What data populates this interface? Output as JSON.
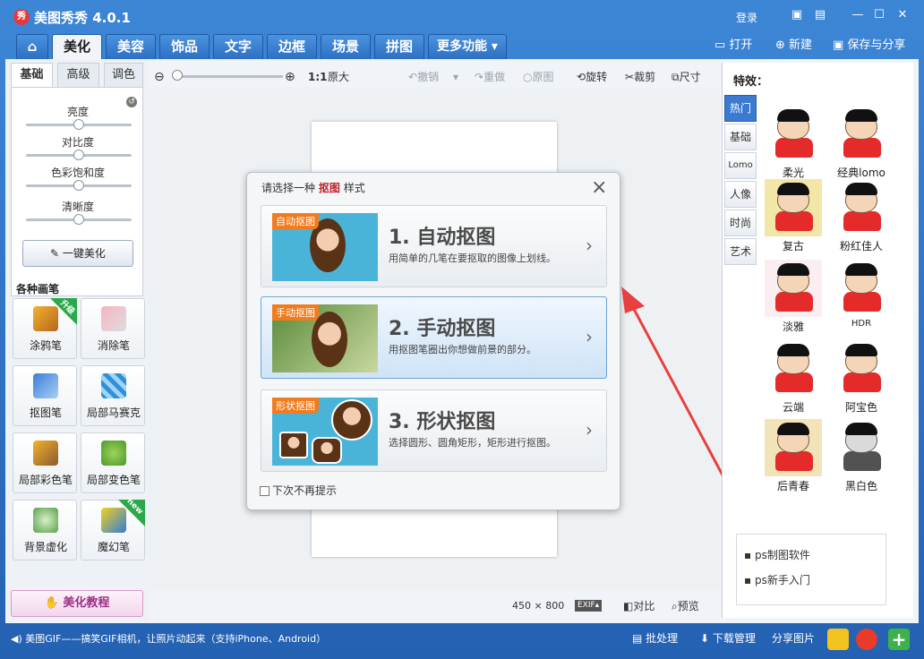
{
  "app": {
    "title": "美图秀秀 4.0.1",
    "logo": "秀",
    "login": "登录"
  },
  "tabs": [
    "美化",
    "美容",
    "饰品",
    "文字",
    "边框",
    "场景",
    "拼图",
    "更多功能 ▾"
  ],
  "right_actions": {
    "open": "打开",
    "new": "新建",
    "save": "保存与分享"
  },
  "left": {
    "subtabs": [
      "基础",
      "高级",
      "调色"
    ],
    "sliders": [
      {
        "label": "亮度",
        "value": 0.5
      },
      {
        "label": "对比度",
        "value": 0.5
      },
      {
        "label": "色彩饱和度",
        "value": 0.5
      },
      {
        "label": "清晰度",
        "value": 0.5
      }
    ],
    "auto_button": "一键美化",
    "brush_title": "各种画笔",
    "tools": [
      {
        "label": "涂鸦笔",
        "badge": "升级"
      },
      {
        "label": "消除笔",
        "badge": ""
      },
      {
        "label": "抠图笔",
        "badge": ""
      },
      {
        "label": "局部马赛克",
        "badge": ""
      },
      {
        "label": "局部彩色笔",
        "badge": ""
      },
      {
        "label": "局部变色笔",
        "badge": ""
      },
      {
        "label": "背景虚化",
        "badge": ""
      },
      {
        "label": "魔幻笔",
        "badge": "new"
      }
    ],
    "tutorial": "美化教程"
  },
  "toolbar": {
    "zoom_ratio": "1:1",
    "original_size": "原大",
    "undo": "撤销",
    "redo": "重做",
    "original": "原图",
    "rotate": "旋转",
    "crop": "裁剪",
    "size": "尺寸"
  },
  "status": {
    "dimensions": "450 × 800",
    "exif": "EXIF▴",
    "compare": "对比",
    "preview": "预览"
  },
  "dialog": {
    "title_prefix": "请选择一种",
    "title_key": "抠图",
    "title_suffix": "样式",
    "options": [
      {
        "tag": "自动抠图",
        "title": "1. 自动抠图",
        "desc": "用简单的几笔在要抠取的图像上划线。"
      },
      {
        "tag": "手动抠图",
        "title": "2. 手动抠图",
        "desc": "用抠图笔圈出你想做前景的部分。"
      },
      {
        "tag": "形状抠图",
        "title": "3. 形状抠图",
        "desc": "选择圆形、圆角矩形，矩形进行抠图。"
      }
    ],
    "no_show": "下次不再提示"
  },
  "effects": {
    "title": "特效：",
    "categories": [
      "热门",
      "基础",
      "Lomo",
      "人像",
      "时尚",
      "艺术"
    ],
    "items": [
      "柔光",
      "经典lomo",
      "复古",
      "粉红佳人",
      "淡雅",
      "HDR",
      "云端",
      "阿宝色",
      "后青春",
      "黑白色"
    ]
  },
  "ads": [
    "ps制图软件",
    "ps新手入门"
  ],
  "bottom": {
    "news": "美图GIF——搞笑GIF相机，让照片动起来（支持iPhone、Android）",
    "batch": "批处理",
    "download": "下载管理",
    "share": "分享图片"
  },
  "colors": {
    "accent": "#2e6fc2",
    "dialog_key": "#c0202a",
    "arrow": "#e8403e"
  }
}
